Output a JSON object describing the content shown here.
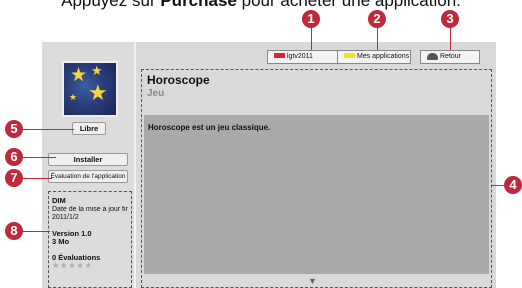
{
  "instruction": {
    "prefix": "Appuyez sur ",
    "bold": "Purchase",
    "suffix": " pour acheter une application."
  },
  "top_buttons": {
    "btn1": "lgtv2011",
    "btn2": "Mes applications",
    "btn3": "Retour"
  },
  "app": {
    "title": "Horoscope",
    "category": "Jeu",
    "description": "Horoscope est un jeu classique.",
    "price_label": "Libre"
  },
  "actions": {
    "install": "Installer",
    "rate": "Évaluation de l'application"
  },
  "info": {
    "publisher": "DIM",
    "update_label": "Date de la mise à jour finale",
    "update_date": "2011/1/2",
    "version": "Version 1.0",
    "size": "3 Mo",
    "ratings": "0 Évaluations",
    "stars": "★★★★★"
  },
  "callouts": [
    "1",
    "2",
    "3",
    "4",
    "5",
    "6",
    "7",
    "8"
  ],
  "colors": {
    "callout": "#c0283c",
    "red_key": "#e0242f",
    "yellow_key": "#f4e21a"
  },
  "icons": {
    "scroll": "▼"
  }
}
